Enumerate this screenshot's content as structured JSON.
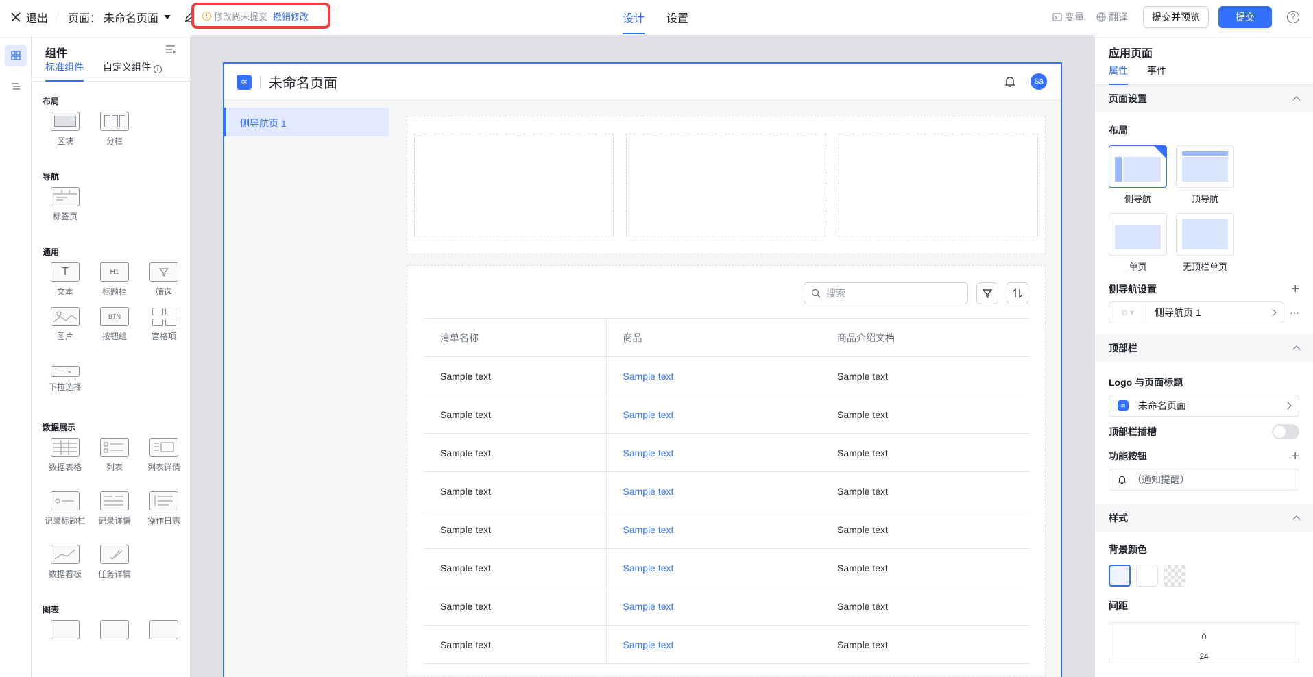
{
  "topbar": {
    "exit_label": "退出",
    "page_prefix": "页面：",
    "page_name": "未命名页面",
    "warning_text": "修改尚未提交",
    "undo_label": "撤销修改",
    "tabs": [
      "设计",
      "设置"
    ],
    "variables_label": "变量",
    "translate_label": "翻译",
    "submit_preview_label": "提交并预览",
    "submit_label": "提交",
    "accent_color": "#3370ff"
  },
  "components": {
    "title": "组件",
    "tabs": [
      "标准组件",
      "自定义组件"
    ],
    "groups": [
      {
        "title": "布局",
        "items": [
          "区块",
          "分栏"
        ]
      },
      {
        "title": "导航",
        "items": [
          "标签页"
        ]
      },
      {
        "title": "通用",
        "items": [
          "文本",
          "标题栏",
          "筛选",
          "图片",
          "按钮组",
          "宫格项",
          "下拉选择"
        ]
      },
      {
        "title": "数据展示",
        "items": [
          "数据表格",
          "列表",
          "列表详情",
          "记录标题栏",
          "记录详情",
          "操作日志",
          "数据看板",
          "任务详情"
        ]
      },
      {
        "title": "图表",
        "items": []
      }
    ],
    "icon_texts": {
      "heading": "H1",
      "button": "BTN",
      "text": "T"
    }
  },
  "canvas": {
    "page_title": "未命名页面",
    "avatar": "Sa",
    "sidenav_items": [
      "侧导航页 1"
    ],
    "search_placeholder": "搜索",
    "columns": [
      "清单名称",
      "商品",
      "商品介绍文档"
    ],
    "rows": [
      [
        "Sample text",
        "Sample text",
        "Sample text"
      ],
      [
        "Sample text",
        "Sample text",
        "Sample text"
      ],
      [
        "Sample text",
        "Sample text",
        "Sample text"
      ],
      [
        "Sample text",
        "Sample text",
        "Sample text"
      ],
      [
        "Sample text",
        "Sample text",
        "Sample text"
      ],
      [
        "Sample text",
        "Sample text",
        "Sample text"
      ],
      [
        "Sample text",
        "Sample text",
        "Sample text"
      ],
      [
        "Sample text",
        "Sample text",
        "Sample text"
      ]
    ]
  },
  "props": {
    "title": "应用页面",
    "tabs": [
      "属性",
      "事件"
    ],
    "page_settings": "页面设置",
    "layout_label": "布局",
    "layouts": [
      "侧导航",
      "顶导航",
      "单页",
      "无顶栏单页"
    ],
    "sidenav_settings": "侧导航设置",
    "sidenav_item": "侧导航页 1",
    "topbar_section": "顶部栏",
    "logo_title_label": "Logo 与页面标题",
    "logo_title_value": "未命名页面",
    "topbar_slot_label": "顶部栏插槽",
    "action_buttons_label": "功能按钮",
    "notify_item": "（通知提醒）",
    "style_section": "样式",
    "bg_color_label": "背景颜色",
    "spacing_label": "间距",
    "spacing_values": [
      "0",
      "24"
    ]
  }
}
